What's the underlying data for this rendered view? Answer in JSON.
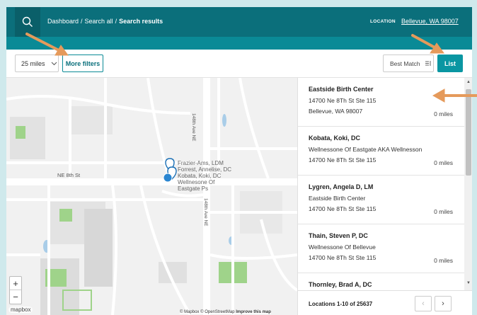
{
  "header": {
    "breadcrumb": {
      "dashboard": "Dashboard",
      "sep1": "/",
      "search_all": "Search all",
      "sep2": "/",
      "current": "Search results"
    },
    "location_label": "LOCATION",
    "location_value": "Bellevue, WA 98007",
    "search_icon": "search-icon"
  },
  "toolbar": {
    "distance": "25 miles",
    "more_filters": "More filters",
    "sort": "Best Match",
    "list": "List"
  },
  "map": {
    "streets": {
      "ne_8th": "NE 8th St",
      "ave_148th_north": "148th Ave NE",
      "ave_148th_south": "148th Ave NE"
    },
    "marker_labels": [
      "Frazier-Ams, LDM",
      "Forrest, Annelise, DC",
      "Kobata, Koki, DC",
      "Wellnesone Of",
      "Eastgate Ps"
    ],
    "zoom_in": "+",
    "zoom_out": "−",
    "logo": "mapbox",
    "attribution": {
      "mapbox": "© Mapbox",
      "osm": "© OpenStreetMap",
      "improve": "Improve this map"
    }
  },
  "results": [
    {
      "name": "Eastside Birth Center",
      "line1": "14700 Ne 8Th St Ste 115",
      "line2": "Bellevue, WA 98007",
      "distance": "0 miles"
    },
    {
      "name": "Kobata, Koki, DC",
      "line1": "Wellnessone Of Eastgate AKA Wellnesson",
      "line2": "14700 Ne 8Th St Ste 115",
      "distance": "0 miles"
    },
    {
      "name": "Lygren, Angela D, LM",
      "line1": "Eastside Birth Center",
      "line2": "14700 Ne 8Th St Ste 115",
      "distance": "0 miles"
    },
    {
      "name": "Thain, Steven P, DC",
      "line1": "Wellnessone Of Bellevue",
      "line2": "14700 Ne 8Th St Ste 115",
      "distance": "0 miles"
    },
    {
      "name": "Thornley, Brad A, DC",
      "line1": "",
      "line2": "",
      "distance": ""
    }
  ],
  "pager": {
    "text": "Locations 1-10 of 25637",
    "prev": "‹",
    "next": "›"
  },
  "colors": {
    "header": "#0b6f7b",
    "accent": "#0a96a2",
    "annotation_arrow": "#e59a5b"
  }
}
